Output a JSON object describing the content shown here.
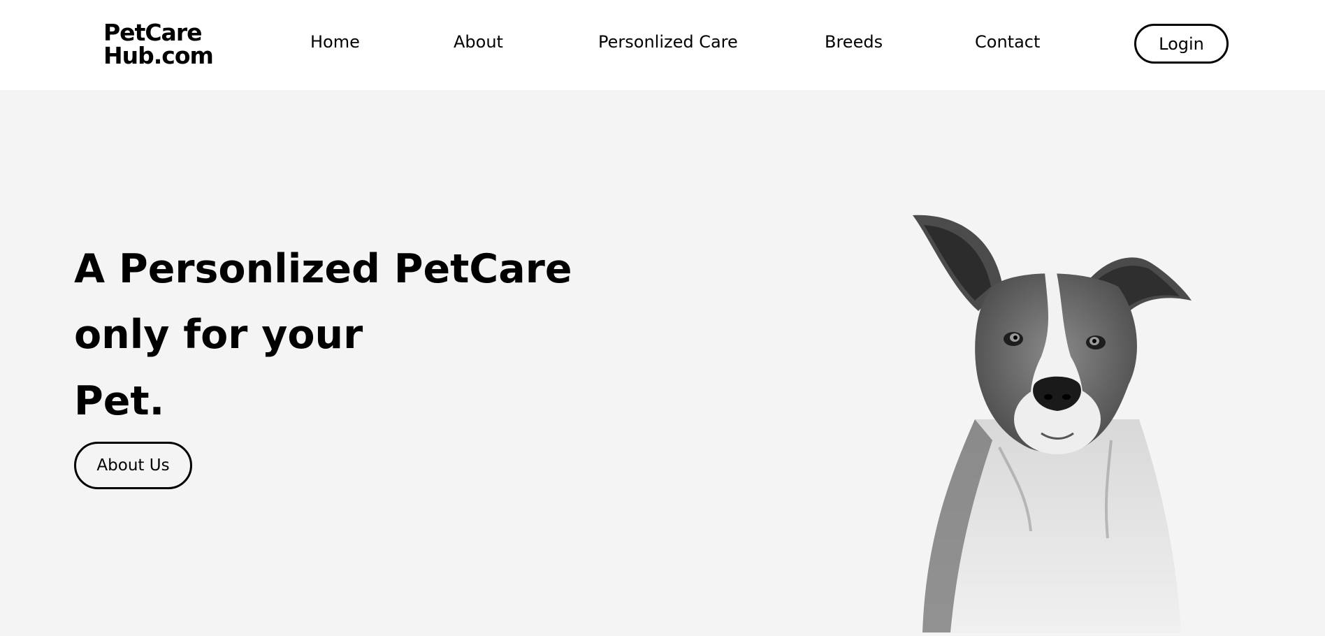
{
  "header": {
    "logo_line1": "PetCare",
    "logo_line2": "Hub.com",
    "nav": [
      "Home",
      "About",
      "Personlized Care",
      "Breeds",
      "Contact"
    ],
    "login_label": "Login"
  },
  "hero": {
    "title_line1": "A Personlized PetCare",
    "title_line2": "only for your",
    "title_line3": "Pet.",
    "about_button_label": "About Us",
    "image_icon": "dog-portrait-image"
  },
  "colors": {
    "background": "#f4f4f4",
    "header_background": "#ffffff",
    "text": "#000000"
  }
}
